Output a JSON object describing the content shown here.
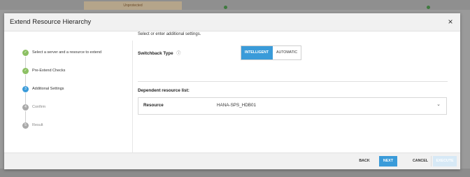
{
  "background": {
    "warning_text": "Unprotected"
  },
  "modal": {
    "title": "Extend Resource Hierarchy",
    "close_symbol": "×"
  },
  "steps": [
    {
      "label": "Select a server and a resource to extend",
      "state": "done",
      "marker": "✓"
    },
    {
      "label": "Pre-Extend Checks",
      "state": "done",
      "marker": "✓"
    },
    {
      "label": "Additional Settings",
      "state": "active",
      "marker": "3"
    },
    {
      "label": "Confirm",
      "state": "pending",
      "marker": "4"
    },
    {
      "label": "Result",
      "state": "pending",
      "marker": "5"
    }
  ],
  "settings": {
    "intro": "Select or enter additional settings.",
    "switchback_label": "Switchback Type",
    "info_symbol": "ⓘ",
    "options": {
      "intelligent": "INTELLIGENT",
      "automatic": "AUTOMATIC"
    },
    "selected": "INTELLIGENT",
    "dependent_label": "Dependent resource list:",
    "resource_key": "Resource",
    "resource_value": "HANA-SPS_HDB01",
    "chevron": "⌄"
  },
  "footer": {
    "back": "BACK",
    "next": "NEXT",
    "cancel": "CANCEL",
    "execute": "EXECUTE"
  },
  "colors": {
    "accent": "#3a9bd9",
    "done": "#8cc063",
    "pending": "#a9a9a9"
  }
}
